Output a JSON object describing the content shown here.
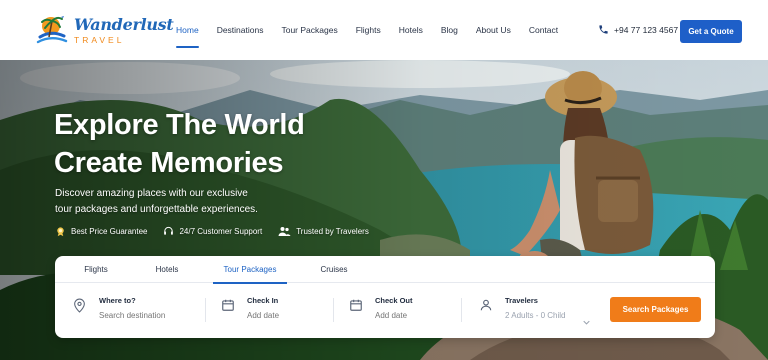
{
  "brand": {
    "name": "Wanderlust",
    "tagline": "TRAVEL"
  },
  "nav": {
    "items": [
      {
        "label": "Home",
        "active": true
      },
      {
        "label": "Destinations",
        "active": false
      },
      {
        "label": "Tour Packages",
        "active": false
      },
      {
        "label": "Flights",
        "active": false
      },
      {
        "label": "Hotels",
        "active": false
      },
      {
        "label": "Blog",
        "active": false
      },
      {
        "label": "About Us",
        "active": false
      },
      {
        "label": "Contact",
        "active": false
      }
    ]
  },
  "header": {
    "phone": "+94 77 123 4567",
    "quote_label": "Get a Quote"
  },
  "hero": {
    "headline_line1": "Explore The World",
    "headline_line2": "Create Memories",
    "sub_line1": "Discover amazing places with our exclusive",
    "sub_line2": "tour packages and unforgettable experiences.",
    "features": [
      {
        "label": "Best Price Guarantee",
        "icon": "badge-icon"
      },
      {
        "label": "24/7 Customer Support",
        "icon": "headset-icon"
      },
      {
        "label": "Trusted by Travelers",
        "icon": "users-icon"
      }
    ]
  },
  "search": {
    "tabs": [
      {
        "label": "Flights",
        "active": false
      },
      {
        "label": "Hotels",
        "active": false
      },
      {
        "label": "Tour Packages",
        "active": true
      },
      {
        "label": "Cruises",
        "active": false
      }
    ],
    "where": {
      "label": "Where to?",
      "placeholder": "Search destination",
      "icon": "location-pin-icon"
    },
    "checkin": {
      "label": "Check In",
      "placeholder": "Add date",
      "icon": "calendar-icon"
    },
    "checkout": {
      "label": "Check Out",
      "placeholder": "Add date",
      "icon": "calendar-icon"
    },
    "travelers": {
      "label": "Travelers",
      "value": "2 Adults - 0 Child",
      "icon": "user-icon"
    },
    "button_label": "Search Packages"
  },
  "colors": {
    "primary": "#1e63c4",
    "accent": "#f07c19",
    "text": "#2a3447"
  }
}
